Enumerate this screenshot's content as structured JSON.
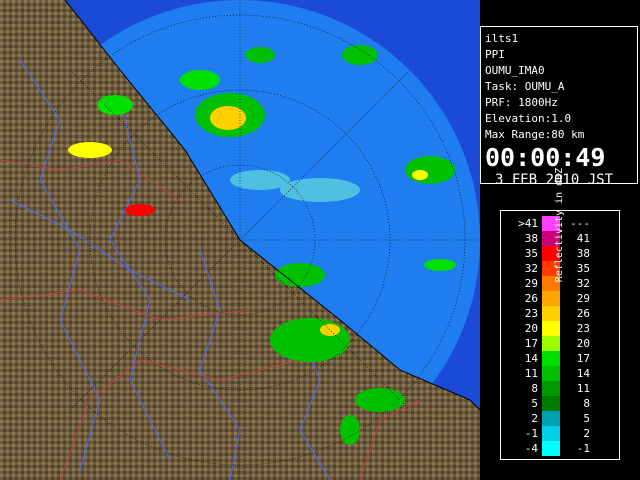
{
  "info": {
    "site": "ilts1",
    "product": "PPI",
    "volume": "OUMU_IMA0",
    "task": "Task: OUMU_A",
    "prf": "PRF: 1800Hz",
    "elevation": "Elevation:1.0",
    "max_range": "Max Range:80 km",
    "time": "00:00:49",
    "date": "3 FEB 2010 JST"
  },
  "legend": {
    "title": "Reflectivity in dBZ",
    "rows": [
      {
        "lo": ">41",
        "hi": "---",
        "color": "#ff40ff"
      },
      {
        "lo": "38",
        "hi": "41",
        "color": "#c8007a"
      },
      {
        "lo": "35",
        "hi": "38",
        "color": "#ff0000"
      },
      {
        "lo": "32",
        "hi": "35",
        "color": "#ff3a00"
      },
      {
        "lo": "29",
        "hi": "32",
        "color": "#ff7c00"
      },
      {
        "lo": "26",
        "hi": "29",
        "color": "#ffa500"
      },
      {
        "lo": "23",
        "hi": "26",
        "color": "#ffd000"
      },
      {
        "lo": "20",
        "hi": "23",
        "color": "#ffff00"
      },
      {
        "lo": "17",
        "hi": "20",
        "color": "#9cff00"
      },
      {
        "lo": "14",
        "hi": "17",
        "color": "#00e000"
      },
      {
        "lo": "11",
        "hi": "14",
        "color": "#00c000"
      },
      {
        "lo": "8",
        "hi": "11",
        "color": "#009a00"
      },
      {
        "lo": "5",
        "hi": "8",
        "color": "#007a00"
      },
      {
        "lo": "2",
        "hi": "5",
        "color": "#00a0b0"
      },
      {
        "lo": "-1",
        "hi": "2",
        "color": "#00d0e8"
      },
      {
        "lo": "-4",
        "hi": "-1",
        "color": "#00ffff"
      }
    ]
  },
  "colors": {
    "sea_outer": "#1a4ad6",
    "sea_range": "#1f7df0",
    "land": "#6b5a3e",
    "rivers": "#4b6cff",
    "borders": "#c04040"
  }
}
